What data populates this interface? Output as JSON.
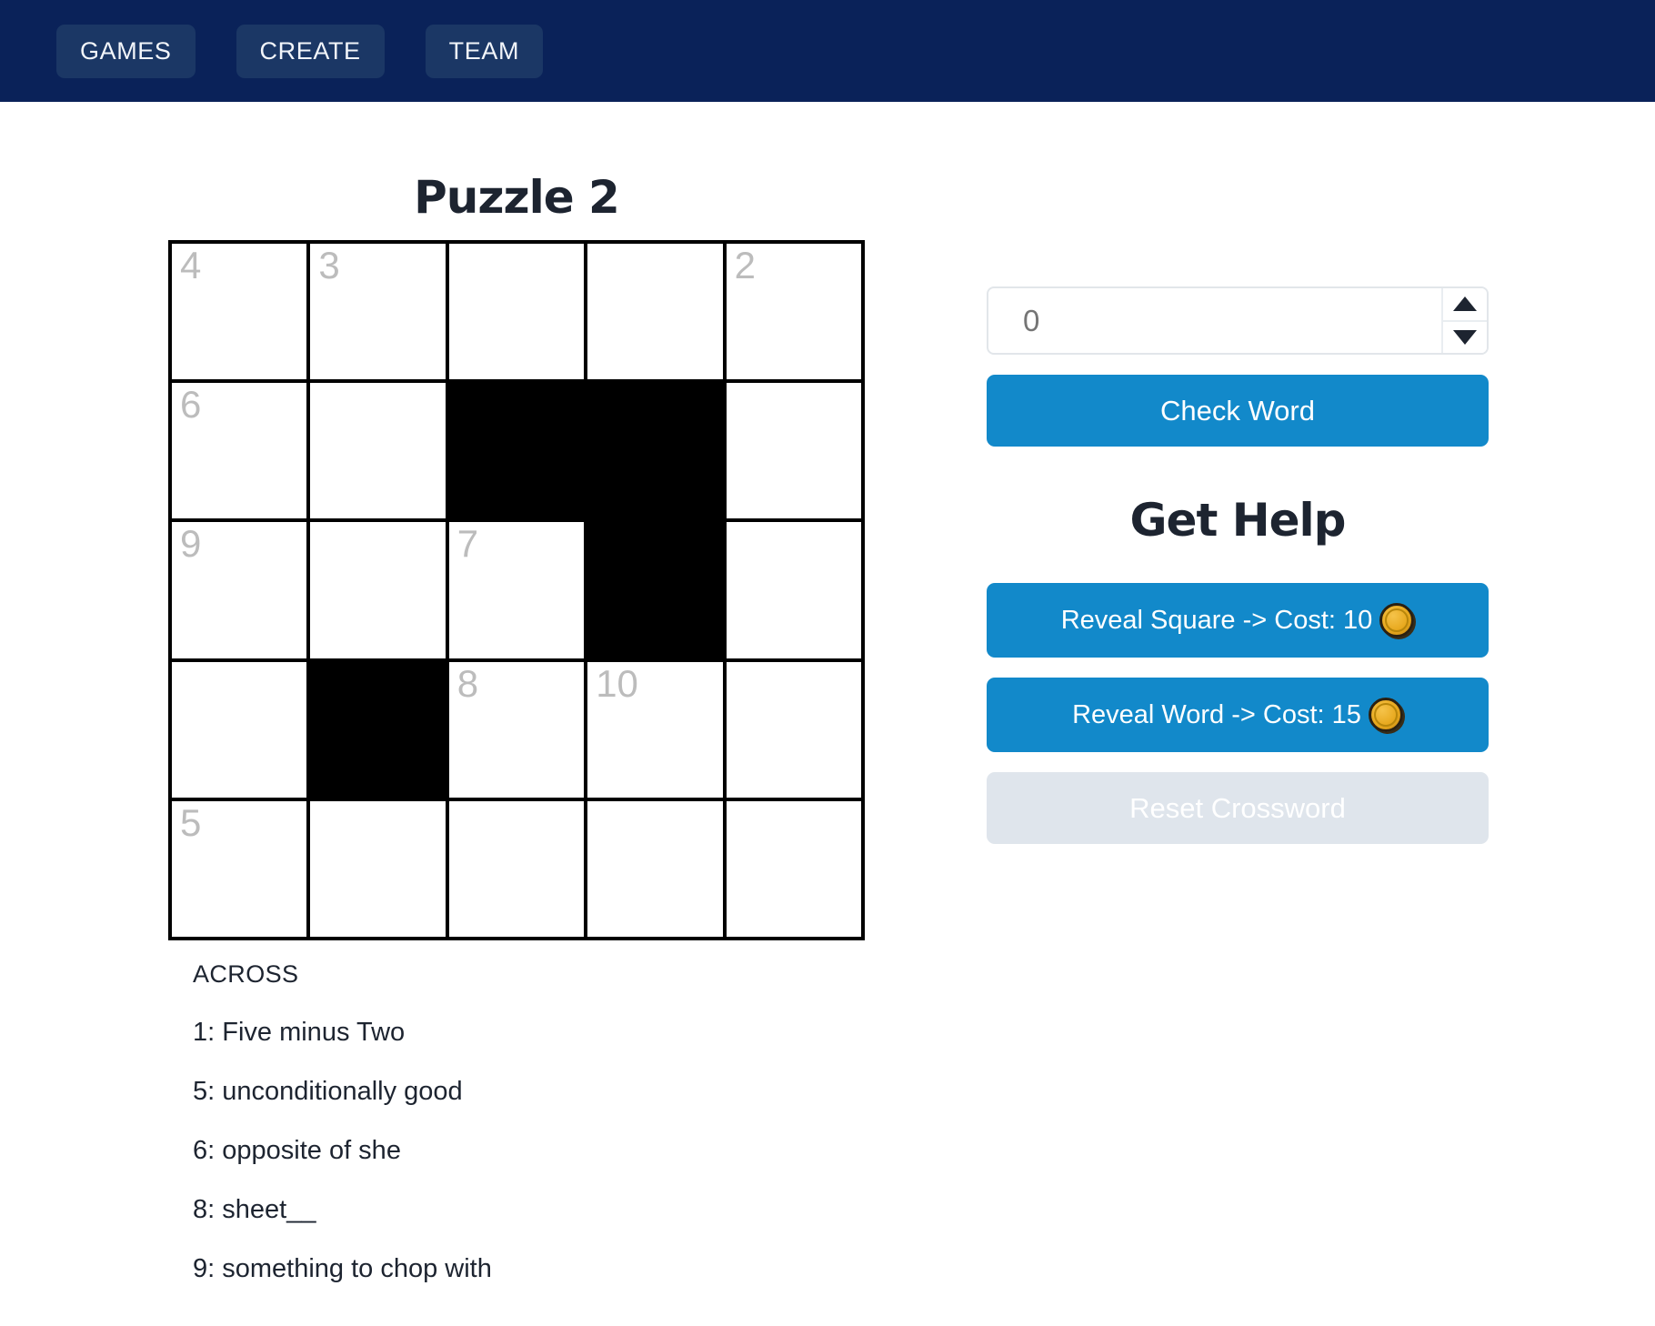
{
  "navbar": {
    "background": "#0a2259",
    "items": [
      {
        "label": "GAMES"
      },
      {
        "label": "CREATE"
      },
      {
        "label": "TEAM"
      }
    ]
  },
  "puzzle": {
    "title": "Puzzle 2",
    "rows": 5,
    "cols": 5,
    "grid": [
      [
        {
          "black": false,
          "number": "4",
          "letter": ""
        },
        {
          "black": false,
          "number": "3",
          "letter": ""
        },
        {
          "black": false,
          "number": "",
          "letter": ""
        },
        {
          "black": false,
          "number": "",
          "letter": ""
        },
        {
          "black": false,
          "number": "2",
          "letter": ""
        }
      ],
      [
        {
          "black": false,
          "number": "6",
          "letter": ""
        },
        {
          "black": false,
          "number": "",
          "letter": ""
        },
        {
          "black": true,
          "number": "",
          "letter": ""
        },
        {
          "black": true,
          "number": "",
          "letter": ""
        },
        {
          "black": false,
          "number": "",
          "letter": ""
        }
      ],
      [
        {
          "black": false,
          "number": "9",
          "letter": ""
        },
        {
          "black": false,
          "number": "",
          "letter": ""
        },
        {
          "black": false,
          "number": "7",
          "letter": ""
        },
        {
          "black": true,
          "number": "",
          "letter": ""
        },
        {
          "black": false,
          "number": "",
          "letter": ""
        }
      ],
      [
        {
          "black": false,
          "number": "",
          "letter": ""
        },
        {
          "black": true,
          "number": "",
          "letter": ""
        },
        {
          "black": false,
          "number": "8",
          "letter": ""
        },
        {
          "black": false,
          "number": "10",
          "letter": ""
        },
        {
          "black": false,
          "number": "",
          "letter": ""
        }
      ],
      [
        {
          "black": false,
          "number": "5",
          "letter": ""
        },
        {
          "black": false,
          "number": "",
          "letter": ""
        },
        {
          "black": false,
          "number": "",
          "letter": ""
        },
        {
          "black": false,
          "number": "",
          "letter": ""
        },
        {
          "black": false,
          "number": "",
          "letter": ""
        }
      ]
    ]
  },
  "clues": {
    "heading": "ACROSS",
    "items": [
      "1: Five minus Two",
      "5: unconditionally good",
      "6: opposite of she",
      "8: sheet__",
      "9: something to chop with"
    ]
  },
  "controls": {
    "number_input": {
      "value": "0",
      "placeholder": "0"
    },
    "spinner_up_icon": "triangle-up-icon",
    "spinner_down_icon": "triangle-down-icon",
    "check_word_label": "Check Word",
    "help_heading": "Get Help",
    "reveal_square_label": "Reveal Square -> Cost: 10",
    "reveal_word_label": "Reveal Word -> Cost: 15",
    "coin_icon": "coin-icon",
    "reset_label": "Reset Crossword",
    "accent_color": "#1289ca",
    "disabled_color": "#dfe5ec"
  }
}
